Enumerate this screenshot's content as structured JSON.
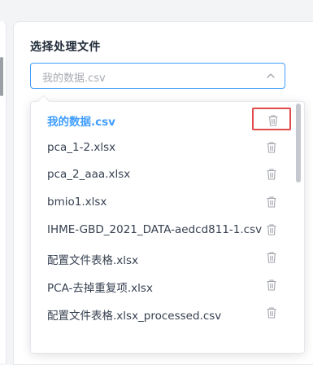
{
  "section": {
    "title": "选择处理文件"
  },
  "select": {
    "value": "我的数据.csv"
  },
  "dropdown": {
    "items": [
      {
        "label": "我的数据.csv",
        "active": true
      },
      {
        "label": "pca_1-2.xlsx"
      },
      {
        "label": "pca_2_aaa.xlsx"
      },
      {
        "label": "bmio1.xlsx"
      },
      {
        "label": "IHME-GBD_2021_DATA-aedcd811-1.csv"
      },
      {
        "label": "配置文件表格.xlsx"
      },
      {
        "label": "PCA-去掉重复项.xlsx"
      },
      {
        "label": "配置文件表格.xlsx_processed.csv"
      }
    ]
  },
  "colors": {
    "accent": "#409eff",
    "highlight_border": "#e14b4b",
    "icon": "#a3a6ad"
  },
  "icons": {
    "item_action": "trash-icon",
    "select_toggle": "chevron-down-icon"
  }
}
